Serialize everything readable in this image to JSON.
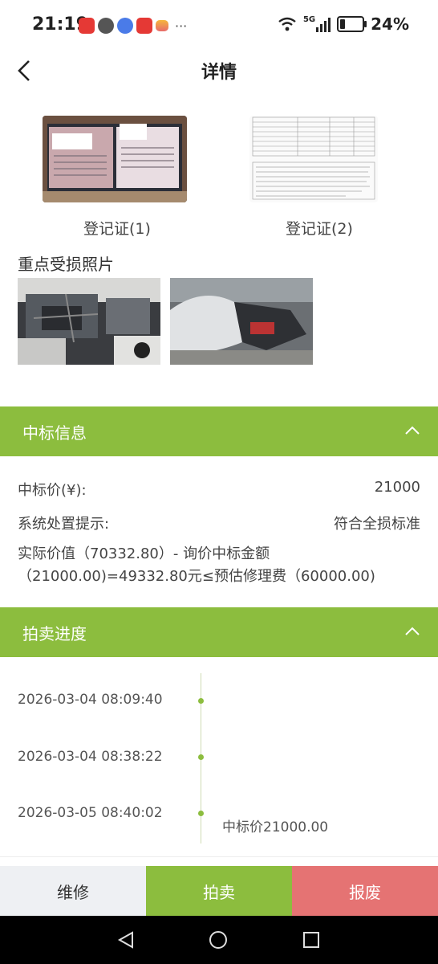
{
  "status_bar": {
    "time": "21:19",
    "signal_label": "5G",
    "battery_percent": "24%",
    "battery_level": 0.24
  },
  "nav": {
    "title": "详情",
    "back_icon": "chevron-left-icon"
  },
  "registration": {
    "items": [
      {
        "caption": "登记证(1)"
      },
      {
        "caption": "登记证(2)"
      }
    ]
  },
  "damage_photos": {
    "title": "重点受损照片"
  },
  "winning_bid": {
    "header": "中标信息",
    "price_label": "中标价(¥):",
    "price_value": "21000",
    "hint_label": "系统处置提示:",
    "hint_value": "符合全损标准",
    "calculation_line1": "实际价值（70332.80）- 询价中标金额",
    "calculation_line2": "（21000.00)=49332.80元≤预估修理费（60000.00)"
  },
  "auction_progress": {
    "header": "拍卖进度",
    "events": [
      {
        "time": "2026-03-04 08:09:40",
        "desc": ""
      },
      {
        "time": "2026-03-04 08:38:22",
        "desc": ""
      },
      {
        "time": "2026-03-05 08:40:02",
        "desc": "中标价21000.00"
      }
    ]
  },
  "bottom_actions": {
    "repair": "维修",
    "auction": "拍卖",
    "scrap": "报废"
  },
  "colors": {
    "accent_green": "#8cbd3e",
    "scrap_red": "#e57373",
    "repair_bg": "#eef0f3"
  }
}
